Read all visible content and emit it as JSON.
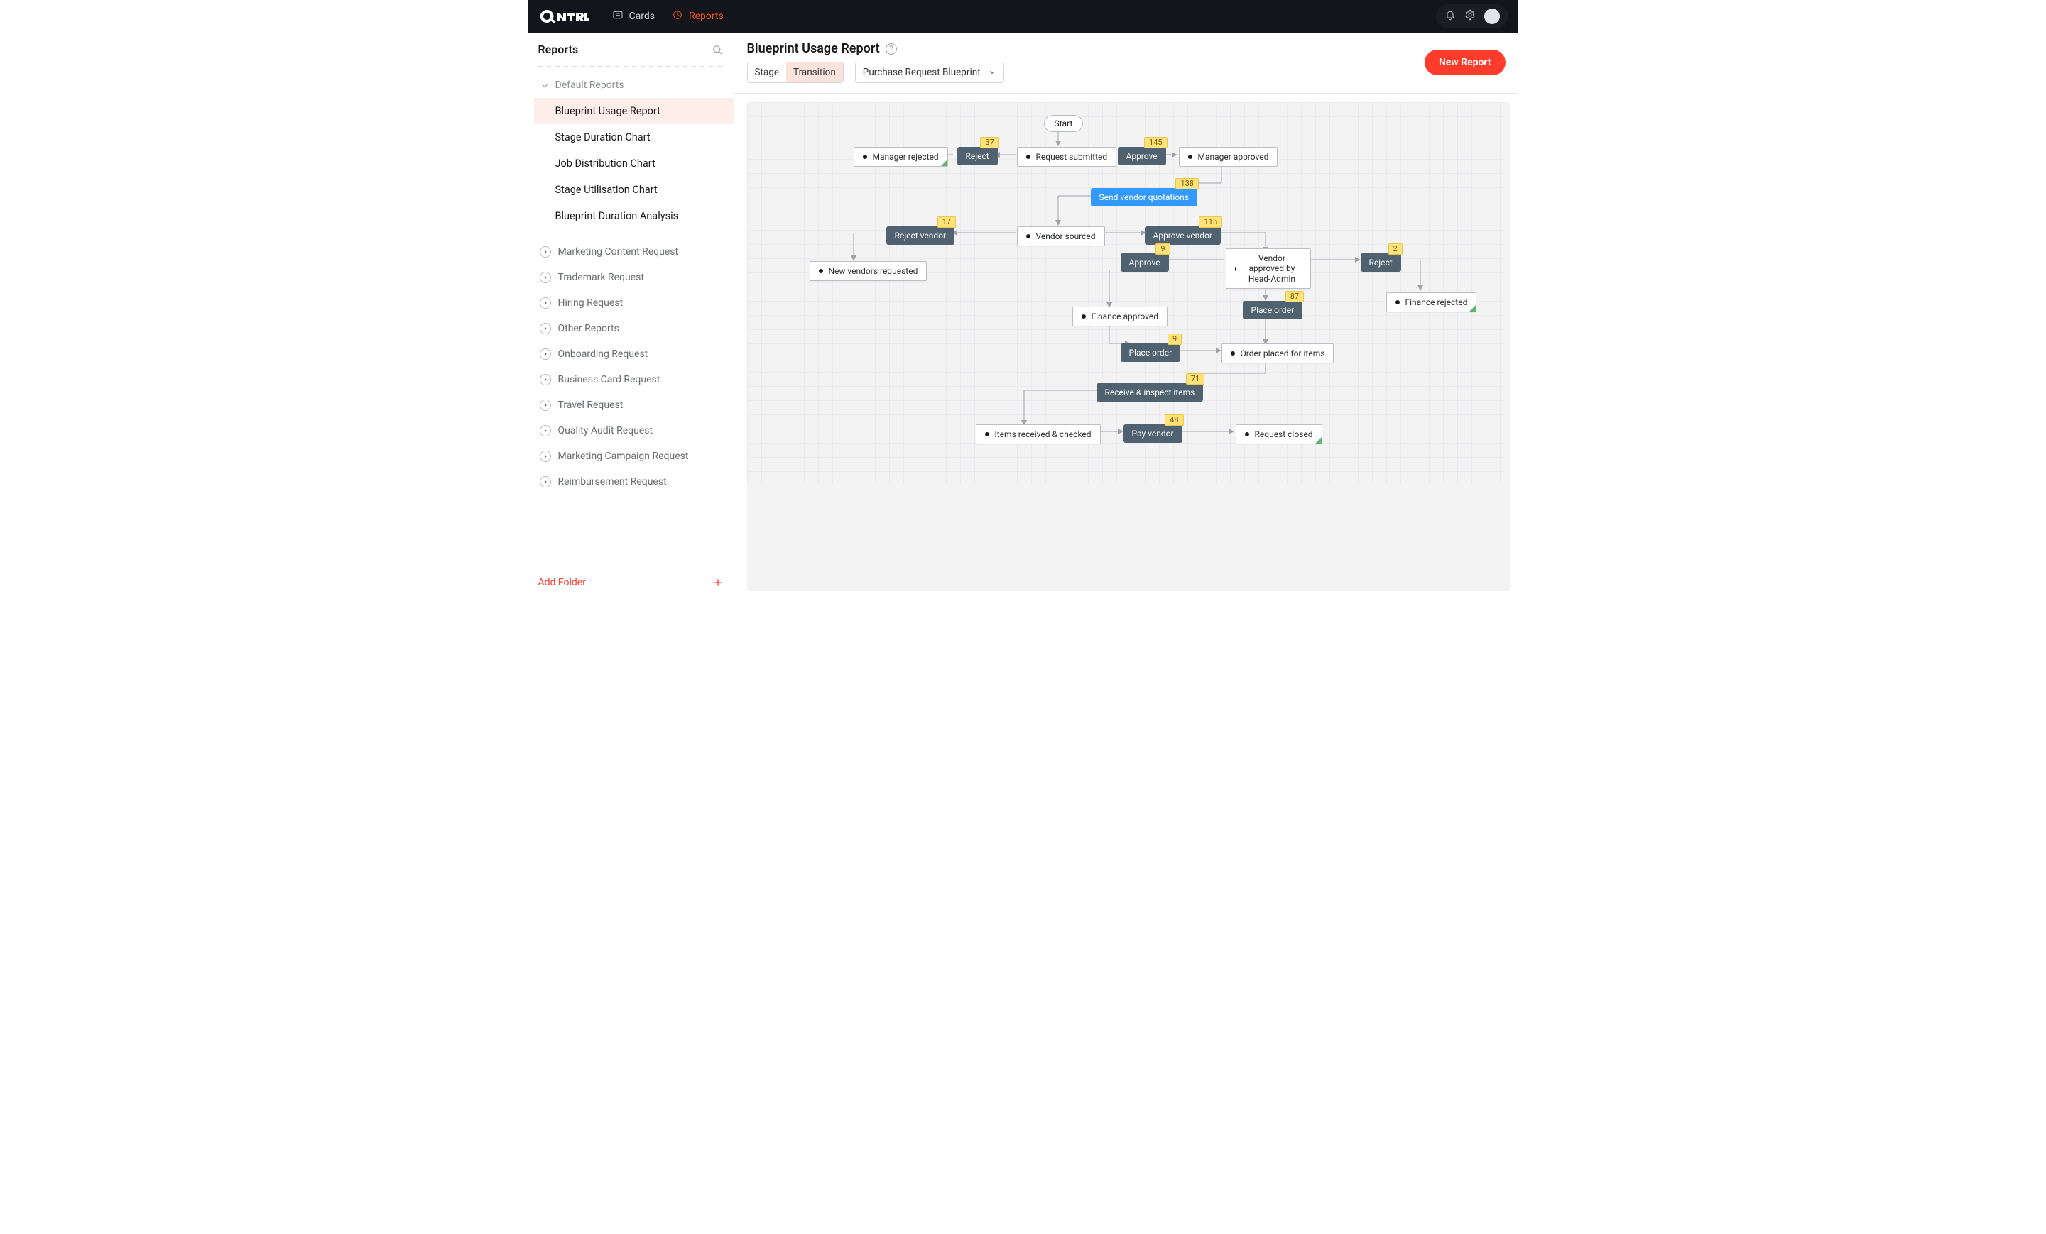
{
  "topnav": {
    "brand": "Qntrl",
    "cards_label": "Cards",
    "reports_label": "Reports"
  },
  "sidebar": {
    "title": "Reports",
    "default_group": "Default Reports",
    "items": [
      {
        "label": "Blueprint Usage Report"
      },
      {
        "label": "Stage Duration Chart"
      },
      {
        "label": "Job Distribution Chart"
      },
      {
        "label": "Stage Utilisation Chart"
      },
      {
        "label": "Blueprint Duration Analysis"
      }
    ],
    "folders": [
      {
        "label": "Marketing Content Request"
      },
      {
        "label": "Trademark Request"
      },
      {
        "label": "Hiring Request"
      },
      {
        "label": "Other Reports"
      },
      {
        "label": "Onboarding Request"
      },
      {
        "label": "Business Card Request"
      },
      {
        "label": "Travel Request"
      },
      {
        "label": "Quality Audit Request"
      },
      {
        "label": "Marketing Campaign Request"
      },
      {
        "label": "Reimbursement Request"
      }
    ],
    "add_folder": "Add Folder"
  },
  "header": {
    "title": "Blueprint Usage Report",
    "seg_stage": "Stage",
    "seg_transition": "Transition",
    "blueprint_name": "Purchase Request Blueprint",
    "new_report": "New Report"
  },
  "bp": {
    "start": "Start",
    "stages": {
      "manager_rejected": "Manager rejected",
      "request_submitted": "Request submitted",
      "manager_approved": "Manager approved",
      "vendor_sourced": "Vendor sourced",
      "new_vendors_requested": "New vendors requested",
      "vendor_approved": "Vendor approved by Head-Admin",
      "finance_rejected": "Finance rejected",
      "finance_approved": "Finance approved",
      "order_placed": "Order placed for items",
      "items_received": "Items received & checked",
      "request_closed": "Request closed"
    },
    "trans": {
      "reject": "Reject",
      "approve": "Approve",
      "send_vendor_quotations": "Send vendor quotations",
      "reject_vendor": "Reject vendor",
      "approve_vendor": "Approve vendor",
      "approve2": "Approve",
      "reject2": "Reject",
      "place_order": "Place order",
      "place_order2": "Place order",
      "receive_inspect": "Receive & inspect items",
      "pay_vendor": "Pay vendor"
    },
    "counts": {
      "reject": "37",
      "approve": "145",
      "send_vendor_quotations": "138",
      "reject_vendor": "17",
      "approve_vendor": "115",
      "approve2": "9",
      "reject2": "2",
      "place_order": "87",
      "place_order2": "9",
      "receive_inspect": "71",
      "pay_vendor": "48"
    }
  }
}
